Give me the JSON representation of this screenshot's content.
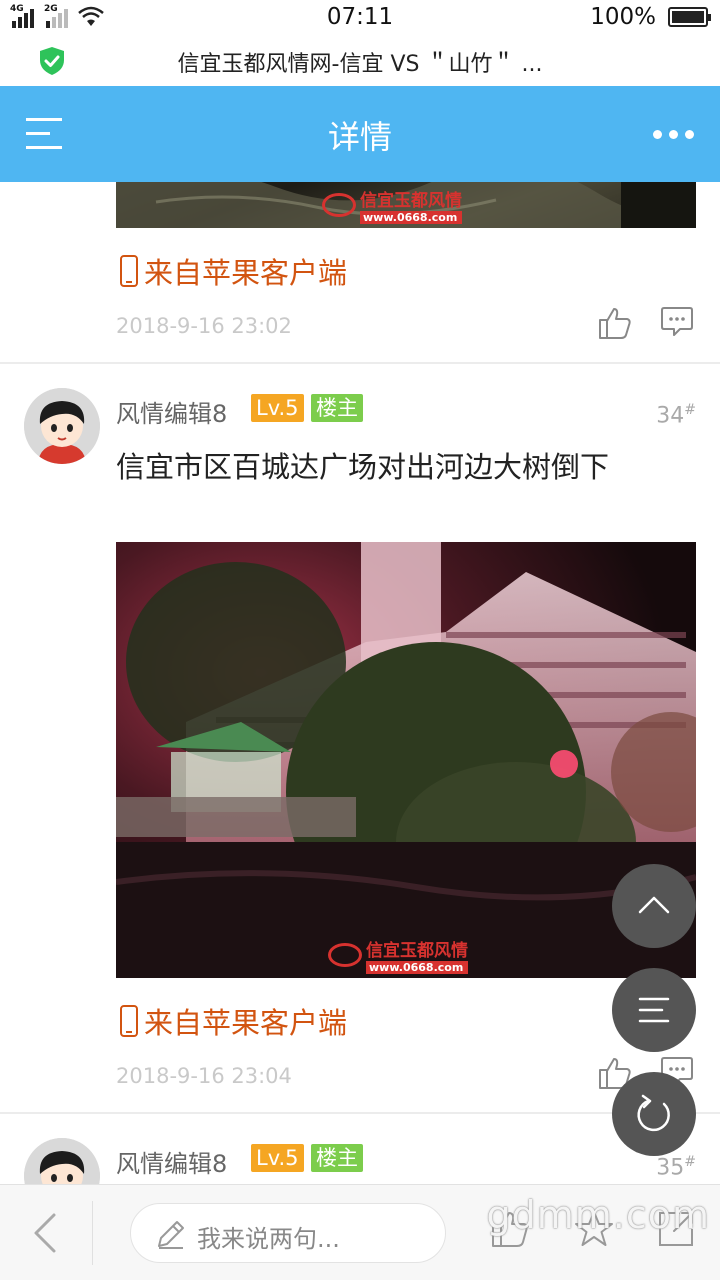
{
  "status_bar": {
    "network_1": "4G",
    "network_2": "2G",
    "time": "07:11",
    "battery": "100%",
    "battery_level": 1.0
  },
  "browser": {
    "title": "信宜玉都风情网-信宜 VS ＂山竹＂ ..."
  },
  "header": {
    "title": "详情"
  },
  "watermark": {
    "brand": "信宜玉都风情",
    "url": "www.0668.com"
  },
  "posts": [
    {
      "source_label": "来自苹果客户端",
      "timestamp": "2018-9-16 23:02"
    },
    {
      "username": "风情编辑8",
      "level": "Lv.5",
      "role": "楼主",
      "floor": "34",
      "floor_mark": "#",
      "text": "信宜市区百城达广场对出河边大树倒下",
      "source_label": "来自苹果客户端",
      "timestamp": "2018-9-16 23:04"
    },
    {
      "username": "风情编辑8",
      "level": "Lv.5",
      "role": "楼主",
      "floor": "35",
      "floor_mark": "#"
    }
  ],
  "bottom_bar": {
    "input_placeholder": "我来说两句...",
    "site_watermark": "gdmm.com"
  },
  "icons": {
    "shield": "shield-check-icon",
    "menu": "hamburger-menu-icon",
    "more": "more-dots-icon",
    "like": "thumbs-up-icon",
    "comment": "comment-icon",
    "scroll_top": "chevron-up-icon",
    "list": "list-menu-icon",
    "refresh": "refresh-icon",
    "back": "chevron-left-icon",
    "edit": "pencil-icon",
    "favorite": "star-icon",
    "share": "share-icon"
  },
  "colors": {
    "header_bg": "#4fb6f2",
    "source_text": "#d25410",
    "level_badge": "#f5a623",
    "host_badge": "#7ccd4c",
    "shield": "#2ec35a"
  }
}
